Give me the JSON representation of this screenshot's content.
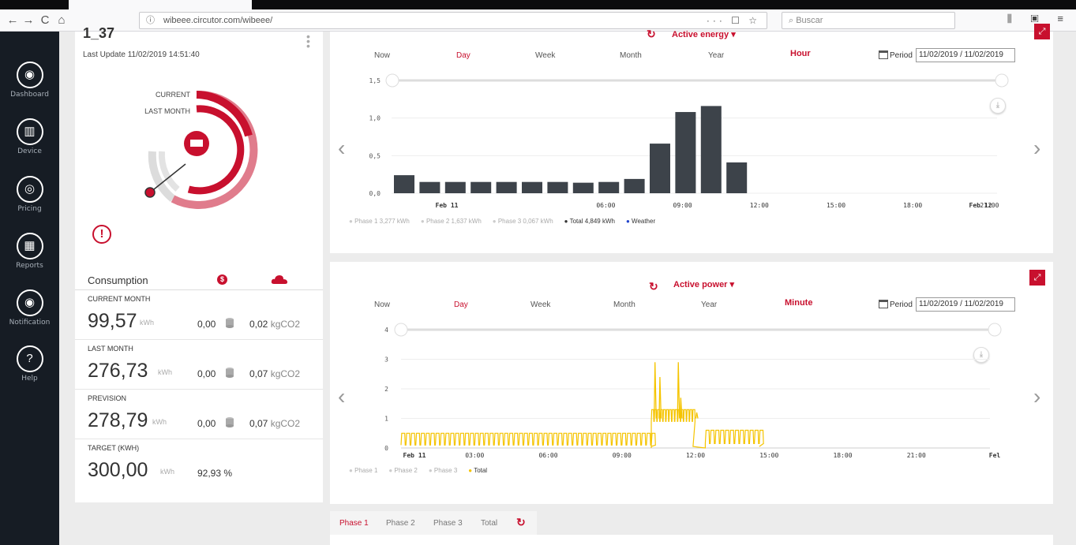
{
  "browser": {
    "url": "wibeee.circutor.com/wibeee/",
    "url_actions": "··· ☐ ☆",
    "search_placeholder": "Buscar",
    "toolbar_right": "⫼ ▣ ≡",
    "nav": {
      "back": "←",
      "forward": "→",
      "reload": "C",
      "home": "⌂"
    }
  },
  "sidebar": {
    "items": [
      {
        "label": "Dashboard",
        "icon": "dashboard-icon",
        "glyph": "◉"
      },
      {
        "label": "Device",
        "icon": "device-icon",
        "glyph": "▥"
      },
      {
        "label": "Pricing",
        "icon": "pricing-icon",
        "glyph": "◎"
      },
      {
        "label": "Reports",
        "icon": "reports-icon",
        "glyph": "▦"
      },
      {
        "label": "Notification",
        "icon": "notification-icon",
        "glyph": "◉"
      },
      {
        "label": "Help",
        "icon": "help-icon",
        "glyph": "?"
      }
    ]
  },
  "device": {
    "name": "1_37",
    "last_update": "Last Update 11/02/2019 14:51:40",
    "ring_current_label": "CURRENT",
    "ring_last_month_label": "LAST MONTH",
    "alert_glyph": "!"
  },
  "consumption": {
    "title": "Consumption",
    "money_glyph": "$",
    "rows": [
      {
        "label": "CURRENT MONTH",
        "value": "99,57",
        "unit": "kWh",
        "cost": "0,00",
        "co2": "0,02",
        "co2_unit": "kgCO2"
      },
      {
        "label": "LAST MONTH",
        "value": "276,73",
        "unit": "kWh",
        "cost": "0,00",
        "co2": "0,07",
        "co2_unit": "kgCO2"
      },
      {
        "label": "PREVISION",
        "value": "278,79",
        "unit": "kWh",
        "cost": "0,00",
        "co2": "0,07",
        "co2_unit": "kgCO2"
      },
      {
        "label": "TARGET (KWH)",
        "value": "300,00",
        "unit": "kWh",
        "percent": "92,93 %"
      }
    ]
  },
  "energy_chart": {
    "title": "Active energy ▾",
    "tabs": [
      "Now",
      "Day",
      "Week",
      "Month",
      "Year"
    ],
    "active_tab": "Day",
    "resolution": "Hour",
    "period_label": "Period",
    "period_value": "11/02/2019 / 11/02/2019",
    "legend": [
      {
        "name": "Phase 1",
        "value": "3,277 kWh",
        "color": "#cccccc"
      },
      {
        "name": "Phase 2",
        "value": "1,637 kWh",
        "color": "#cccccc"
      },
      {
        "name": "Phase 3",
        "value": "0,067 kWh",
        "color": "#cccccc"
      },
      {
        "name": "Total",
        "value": "4,849 kWh",
        "color": "#333333"
      },
      {
        "name": "Weather",
        "value": "",
        "color": "#2244cc"
      }
    ]
  },
  "power_chart": {
    "title": "Active power ▾",
    "tabs": [
      "Now",
      "Day",
      "Week",
      "Month",
      "Year"
    ],
    "active_tab": "Day",
    "resolution": "Minute",
    "period_label": "Period",
    "period_value": "11/02/2019 / 11/02/2019",
    "legend": [
      {
        "name": "Phase 1",
        "color": "#cccccc"
      },
      {
        "name": "Phase 2",
        "color": "#cccccc"
      },
      {
        "name": "Phase 3",
        "color": "#cccccc"
      },
      {
        "name": "Total",
        "color": "#f5c400"
      }
    ]
  },
  "bottom_tabs": {
    "items": [
      "Phase 1",
      "Phase 2",
      "Phase 3",
      "Total"
    ],
    "active": "Phase 1"
  },
  "colors": {
    "accent": "#c8102e",
    "sidebar": "#161c24",
    "bar": "#3d434a",
    "line": "#f5c400"
  },
  "chart_data": [
    {
      "type": "bar",
      "title": "Active energy",
      "x": [
        "00:00",
        "01:00",
        "02:00",
        "03:00",
        "04:00",
        "05:00",
        "06:00",
        "07:00",
        "08:00",
        "09:00",
        "10:00",
        "11:00",
        "12:00",
        "13:00"
      ],
      "values": [
        0.24,
        0.15,
        0.15,
        0.15,
        0.15,
        0.15,
        0.15,
        0.14,
        0.15,
        0.19,
        0.66,
        1.08,
        1.16,
        0.41
      ],
      "x_tick_labels": [
        "Feb 11",
        "06:00",
        "09:00",
        "12:00",
        "15:00",
        "18:00",
        "21:00",
        "Feb 12"
      ],
      "y_ticks": [
        "0,0",
        "0,5",
        "1,0",
        "1,5"
      ],
      "ylim": [
        0,
        1.5
      ],
      "color": "#3d434a"
    },
    {
      "type": "line",
      "title": "Active power",
      "series": [
        {
          "name": "Total",
          "color": "#f5c400"
        }
      ],
      "x_tick_labels": [
        "Feb 11",
        "03:00",
        "06:00",
        "09:00",
        "12:00",
        "15:00",
        "18:00",
        "21:00",
        "Fel"
      ],
      "y_ticks": [
        "0",
        "1",
        "2",
        "3",
        "4"
      ],
      "ylim": [
        0,
        4
      ],
      "x_range_hours": [
        0,
        24
      ],
      "segments": [
        {
          "from_h": 0.0,
          "to_h": 10.2,
          "low": 0.1,
          "high": 0.5,
          "period_h": 0.2
        },
        {
          "from_h": 10.2,
          "to_h": 11.9,
          "low": 0.9,
          "high": 1.3,
          "period_h": 0.12
        },
        {
          "from_h": 12.4,
          "to_h": 14.6,
          "low": 0.15,
          "high": 0.6,
          "period_h": 0.2
        }
      ],
      "spikes": [
        {
          "h": 10.35,
          "value": 2.9
        },
        {
          "h": 10.55,
          "value": 2.4
        },
        {
          "h": 11.3,
          "value": 2.9
        },
        {
          "h": 11.4,
          "value": 1.7
        },
        {
          "h": 12.05,
          "value": 1.2
        }
      ]
    }
  ]
}
